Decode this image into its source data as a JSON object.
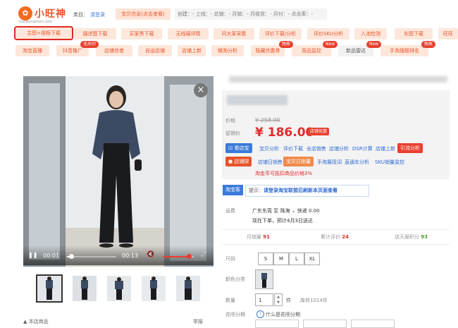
{
  "toolbar": {
    "brand": "小旺神",
    "brand_domain": "xiaowangshen.com",
    "category_label": "类目：",
    "login_link": "请登录",
    "info_button": "宝贝信息(点击查看)",
    "stats_line": "创建：- 上线：- 总销：- 月销：- 月收货：- 月付：- 点击率：-",
    "row1": [
      "主图+视频下载",
      "描述图下载",
      "买家秀下载",
      "无线端详情",
      "问大家采集",
      "评价下载/分析",
      "评价SKU分析",
      "入池检测",
      "车图下载",
      "旺旺"
    ],
    "row2": [
      "淘宝直播",
      "抖音推广",
      "店铺信者",
      "自运店铺",
      "店铺上新",
      "微淘分析",
      "隐藏优惠券",
      "竞品监控",
      "新品雷达",
      "手淘搜题排名"
    ],
    "badges": {
      "no_watermark": "无水印",
      "exclusive_1": "独家",
      "new_1": "New",
      "new_2": "New",
      "exclusive_2": "独家"
    }
  },
  "player": {
    "current_time": "00:01",
    "duration": "00:13",
    "progress": 0.08,
    "volume": 0.85
  },
  "price": {
    "price_label": "价格",
    "original_price": "¥ 258.00",
    "promo_label": "促销价",
    "promo_price": "¥ 186.00",
    "shop_offer_tag": "店铺优惠"
  },
  "tools": {
    "kanbao_button": "看店宝",
    "kanbao_links": [
      "宝贝分析",
      "评价下载",
      "全店销售",
      "店铺分析",
      "DSR计算",
      "店铺上新"
    ],
    "kanbao_highlight": "引流分析",
    "dianzhang_button": "店铺探",
    "dianzhang_tag": "宝贝日销量",
    "dianzhang_links": [
      "店铺日销售",
      "手淘展现词",
      "直通车分析",
      "SKU销量监控"
    ],
    "coupon_note": "淘金币可抵扣商品价格3%"
  },
  "taobao_tip": {
    "tag": "淘宝客",
    "text_prefix": "提示：",
    "text_link": "请登录淘宝联盟后刷新本页面查看"
  },
  "shipping": {
    "label": "运费",
    "route": "广东东莞 至 珠海",
    "method": "快递 0.00",
    "eta": "现在下单，预计4月3日送达"
  },
  "sales": {
    "monthly_label": "月销量",
    "monthly_value": "91",
    "reviews_label": "累计评价",
    "reviews_value": "24",
    "points_label": "送天猫积分",
    "points_value": "93"
  },
  "sku": {
    "size_label": "尺码",
    "sizes": [
      "S",
      "M",
      "L",
      "XL"
    ],
    "color_label": "颜色分类",
    "qty_label": "数量",
    "qty_value": "1",
    "qty_unit": "件",
    "stock": "库存1014件",
    "installment_label": "花呗分期",
    "installment_question": "什么是花呗分期"
  },
  "footer": {
    "left_text": "▲ 本店商品",
    "right_text": "举报"
  },
  "colors": {
    "accent_orange": "#e8542a",
    "price_red": "#e02b2b",
    "link_blue": "#2f6ad0"
  }
}
